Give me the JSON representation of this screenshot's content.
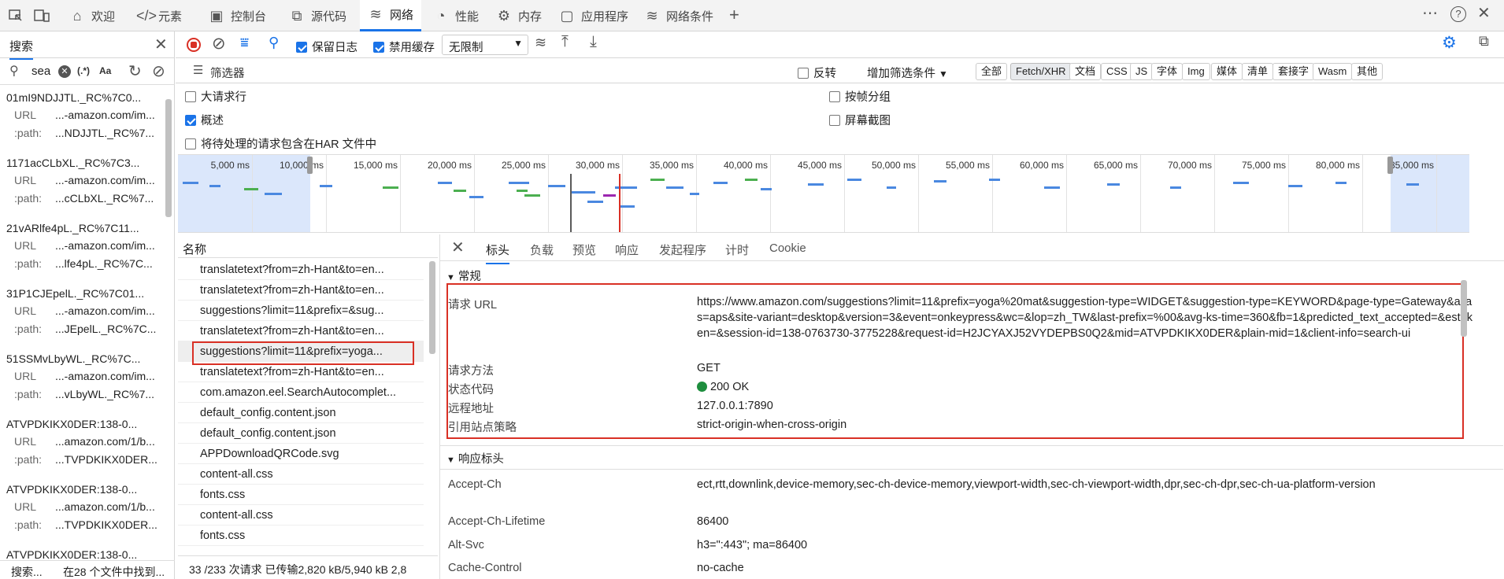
{
  "tabs": [
    {
      "label": "欢迎",
      "icon": "home-icon"
    },
    {
      "label": "元素",
      "icon": "code-icon"
    },
    {
      "label": "控制台",
      "icon": "console-icon"
    },
    {
      "label": "源代码",
      "icon": "sources-icon"
    },
    {
      "label": "网络",
      "icon": "wifi-icon"
    },
    {
      "label": "性能",
      "icon": "performance-icon"
    },
    {
      "label": "内存",
      "icon": "memory-icon"
    },
    {
      "label": "应用程序",
      "icon": "application-icon"
    },
    {
      "label": "网络条件",
      "icon": "network-conditions-icon"
    }
  ],
  "search_panel": {
    "tab": "搜索",
    "query": "sea",
    "regex_label": "(.*)",
    "case_label": "Aa",
    "results": [
      {
        "title": "01mI9NDJJTL._RC%7C0...",
        "url": "...-amazon.com/im...",
        "path": "...NDJJTL._RC%7..."
      },
      {
        "title": "1171acCLbXL._RC%7C3...",
        "url": "...-amazon.com/im...",
        "path": "...cCLbXL._RC%7..."
      },
      {
        "title": "21vARlfe4pL._RC%7C11...",
        "url": "...-amazon.com/im...",
        "path": "...lfe4pL._RC%7C..."
      },
      {
        "title": "31P1CJEpelL._RC%7C01...",
        "url": "...-amazon.com/im...",
        "path": "...JEpelL._RC%7C..."
      },
      {
        "title": "51SSMvLbyWL._RC%7C...",
        "url": "...-amazon.com/im...",
        "path": "...vLbyWL._RC%7..."
      },
      {
        "title": "ATVPDKIKX0DER:138-0...",
        "url": "...amazon.com/1/b...",
        "path": "...TVPDKIKX0DER..."
      },
      {
        "title": "ATVPDKIKX0DER:138-0...",
        "url": "...amazon.com/1/b...",
        "path": "...TVPDKIKX0DER..."
      },
      {
        "title": "ATVPDKIKX0DER:138-0...",
        "url": "",
        "path": ""
      }
    ],
    "url_key": "URL",
    "path_key": ":path:",
    "status_left": "搜索...",
    "status_right": "在28 个文件中找到..."
  },
  "toolbar": {
    "preserve_log": "保留日志",
    "disable_cache": "禁用缓存",
    "throttle": "无限制"
  },
  "filterbar": {
    "placeholder": "筛选器",
    "invert": "反转",
    "more_filters": "增加筛选条件",
    "chips": [
      "全部",
      "Fetch/XHR",
      "文档",
      "CSS",
      "JS",
      "字体",
      "Img",
      "媒体",
      "清单",
      "套接字",
      "Wasm",
      "其他"
    ]
  },
  "options": {
    "big_rows": "大请求行",
    "overview": "概述",
    "har": "将待处理的请求包含在HAR 文件中",
    "group_by_frame": "按帧分组",
    "screenshots": "屏幕截图"
  },
  "timeline_ticks": [
    "5,000 ms",
    "10,000 ms",
    "15,000 ms",
    "20,000 ms",
    "25,000 ms",
    "30,000 ms",
    "35,000 ms",
    "40,000 ms",
    "45,000 ms",
    "50,000 ms",
    "55,000 ms",
    "60,000 ms",
    "65,000 ms",
    "70,000 ms",
    "75,000 ms",
    "80,000 ms",
    "85,000 ms",
    "90,"
  ],
  "request_list": {
    "header": "名称",
    "items": [
      "translatetext?from=zh-Hant&to=en...",
      "translatetext?from=zh-Hant&to=en...",
      "suggestions?limit=11&prefix=&sug...",
      "translatetext?from=zh-Hant&to=en...",
      "suggestions?limit=11&prefix=yoga...",
      "translatetext?from=zh-Hant&to=en...",
      "com.amazon.eel.SearchAutocomplet...",
      "default_config.content.json",
      "default_config.content.json",
      "APPDownloadQRCode.svg",
      "content-all.css",
      "fonts.css",
      "content-all.css",
      "fonts.css"
    ],
    "status": "33 /233 次请求   已传输2,820 kB/5,940 kB   2,8"
  },
  "details": {
    "tabs": [
      "标头",
      "负载",
      "预览",
      "响应",
      "发起程序",
      "计时",
      "Cookie"
    ],
    "general_title": "常规",
    "general": [
      {
        "key": "请求 URL",
        "value": "https://www.amazon.com/suggestions?limit=11&prefix=yoga%20mat&suggestion-type=WIDGET&suggestion-type=KEYWORD&page-type=Gateway&alias=aps&site-variant=desktop&version=3&event=onkeypress&wc=&lop=zh_TW&last-prefix=%00&avg-ks-time=360&fb=1&predicted_text_accepted=&estoken=&session-id=138-0763730-3775228&request-id=H2JCYAXJ52VYDEPBS0Q2&mid=ATVPDKIKX0DER&plain-mid=1&client-info=search-ui"
      },
      {
        "key": "请求方法",
        "value": "GET"
      },
      {
        "key": "状态代码",
        "value": "200 OK"
      },
      {
        "key": "远程地址",
        "value": "127.0.0.1:7890"
      },
      {
        "key": "引用站点策略",
        "value": "strict-origin-when-cross-origin"
      }
    ],
    "response_title": "响应标头",
    "response": [
      {
        "key": "Accept-Ch",
        "value": "ect,rtt,downlink,device-memory,sec-ch-device-memory,viewport-width,sec-ch-viewport-width,dpr,sec-ch-dpr,sec-ch-ua-platform-version"
      },
      {
        "key": "Accept-Ch-Lifetime",
        "value": "86400"
      },
      {
        "key": "Alt-Svc",
        "value": "h3=\":443\"; ma=86400"
      },
      {
        "key": "Cache-Control",
        "value": "no-cache"
      }
    ]
  },
  "colors": {
    "accent": "#1a73e8",
    "highlight": "#d93025",
    "status_ok": "#1e8e3e"
  }
}
